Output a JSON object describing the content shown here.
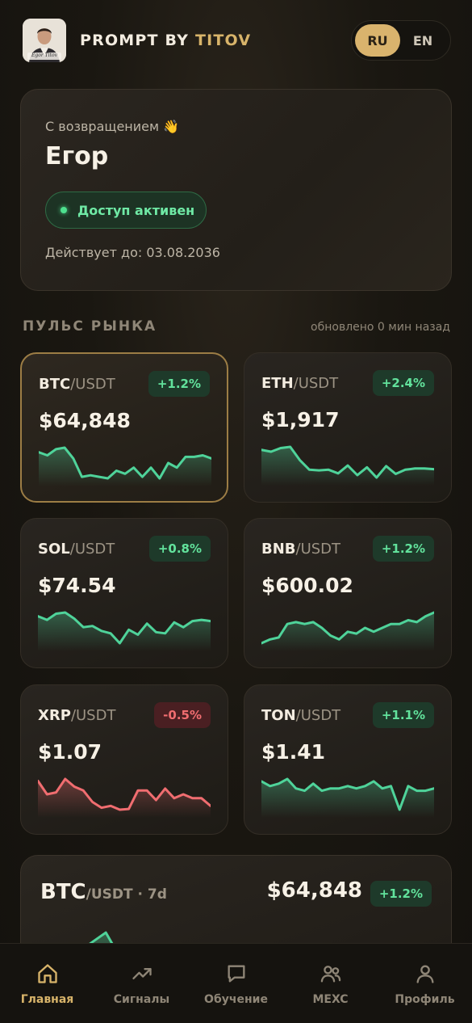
{
  "header": {
    "brand_main": "PROMPT BY ",
    "brand_accent": "TITOV",
    "avatar_caption": "Egor Titov",
    "lang": [
      "RU",
      "EN"
    ],
    "lang_active": "RU"
  },
  "welcome": {
    "greeting": "С возвращением 👋",
    "name": "Егор",
    "access_status": "Доступ активен",
    "valid_until": "Действует до: 03.08.2036"
  },
  "market": {
    "title": "ПУЛЬС РЫНКА",
    "updated": "обновлено 0 мин назад",
    "colors": {
      "up": "#4fd39a",
      "down": "#f06d70",
      "accent": "#d8b46a"
    },
    "tickers": [
      {
        "base": "BTC",
        "quote": "/USDT",
        "change": "+1.2%",
        "price": "$64,848",
        "trend": "up",
        "spark": [
          64.72,
          64.7,
          64.74,
          64.75,
          64.68,
          64.56,
          64.57,
          64.56,
          64.55,
          64.6,
          64.58,
          64.62,
          64.56,
          64.62,
          64.55,
          64.65,
          64.62,
          64.69,
          64.69,
          64.7,
          64.68
        ]
      },
      {
        "base": "ETH",
        "quote": "/USDT",
        "change": "+2.4%",
        "price": "$1,917",
        "trend": "up",
        "spark": [
          1916.5,
          1916.2,
          1916.8,
          1917.0,
          1914.8,
          1913.2,
          1913.1,
          1913.2,
          1912.6,
          1913.9,
          1912.3,
          1913.6,
          1911.9,
          1913.8,
          1912.5,
          1913.2,
          1913.4,
          1913.4,
          1913.3
        ]
      },
      {
        "base": "SOL",
        "quote": "/USDT",
        "change": "+0.8%",
        "price": "$74.54",
        "trend": "up",
        "spark": [
          74.55,
          74.52,
          74.57,
          74.58,
          74.53,
          74.46,
          74.47,
          74.43,
          74.41,
          74.33,
          74.44,
          74.4,
          74.49,
          74.42,
          74.41,
          74.5,
          74.46,
          74.51,
          74.52,
          74.51
        ]
      },
      {
        "base": "BNB",
        "quote": "/USDT",
        "change": "+1.2%",
        "price": "$600.02",
        "trend": "up",
        "spark": [
          599.2,
          599.4,
          599.5,
          600.2,
          600.3,
          600.2,
          600.3,
          600.0,
          599.6,
          599.4,
          599.8,
          599.7,
          600.0,
          599.8,
          600.0,
          600.2,
          600.2,
          600.4,
          600.3,
          600.6,
          600.8
        ]
      },
      {
        "base": "XRP",
        "quote": "/USDT",
        "change": "-0.5%",
        "price": "$1.07",
        "trend": "down",
        "spark": [
          1.0755,
          1.072,
          1.0725,
          1.076,
          1.074,
          1.073,
          1.07,
          1.0685,
          1.069,
          1.068,
          1.0682,
          1.073,
          1.073,
          1.0705,
          1.0735,
          1.071,
          1.072,
          1.071,
          1.071,
          1.069
        ]
      },
      {
        "base": "TON",
        "quote": "/USDT",
        "change": "+1.1%",
        "price": "$1.41",
        "trend": "up",
        "spark": [
          1.412,
          1.41,
          1.411,
          1.413,
          1.409,
          1.408,
          1.411,
          1.408,
          1.409,
          1.409,
          1.41,
          1.409,
          1.41,
          1.412,
          1.409,
          1.41,
          1.4,
          1.41,
          1.408,
          1.408,
          1.409
        ]
      }
    ]
  },
  "big_chart": {
    "base": "BTC",
    "quote": "/USDT · 7d",
    "price": "$64,848",
    "change": "+1.2%",
    "spark": [
      63.6,
      63.9,
      64.2,
      64.7,
      64.9,
      64.4,
      64.0,
      63.5
    ]
  },
  "nav": [
    {
      "label": "Главная",
      "icon": "home-icon",
      "active": true
    },
    {
      "label": "Сигналы",
      "icon": "trend-icon",
      "active": false
    },
    {
      "label": "Обучение",
      "icon": "chat-icon",
      "active": false
    },
    {
      "label": "MEXC",
      "icon": "users-icon",
      "active": false
    },
    {
      "label": "Профиль",
      "icon": "profile-icon",
      "active": false
    }
  ]
}
